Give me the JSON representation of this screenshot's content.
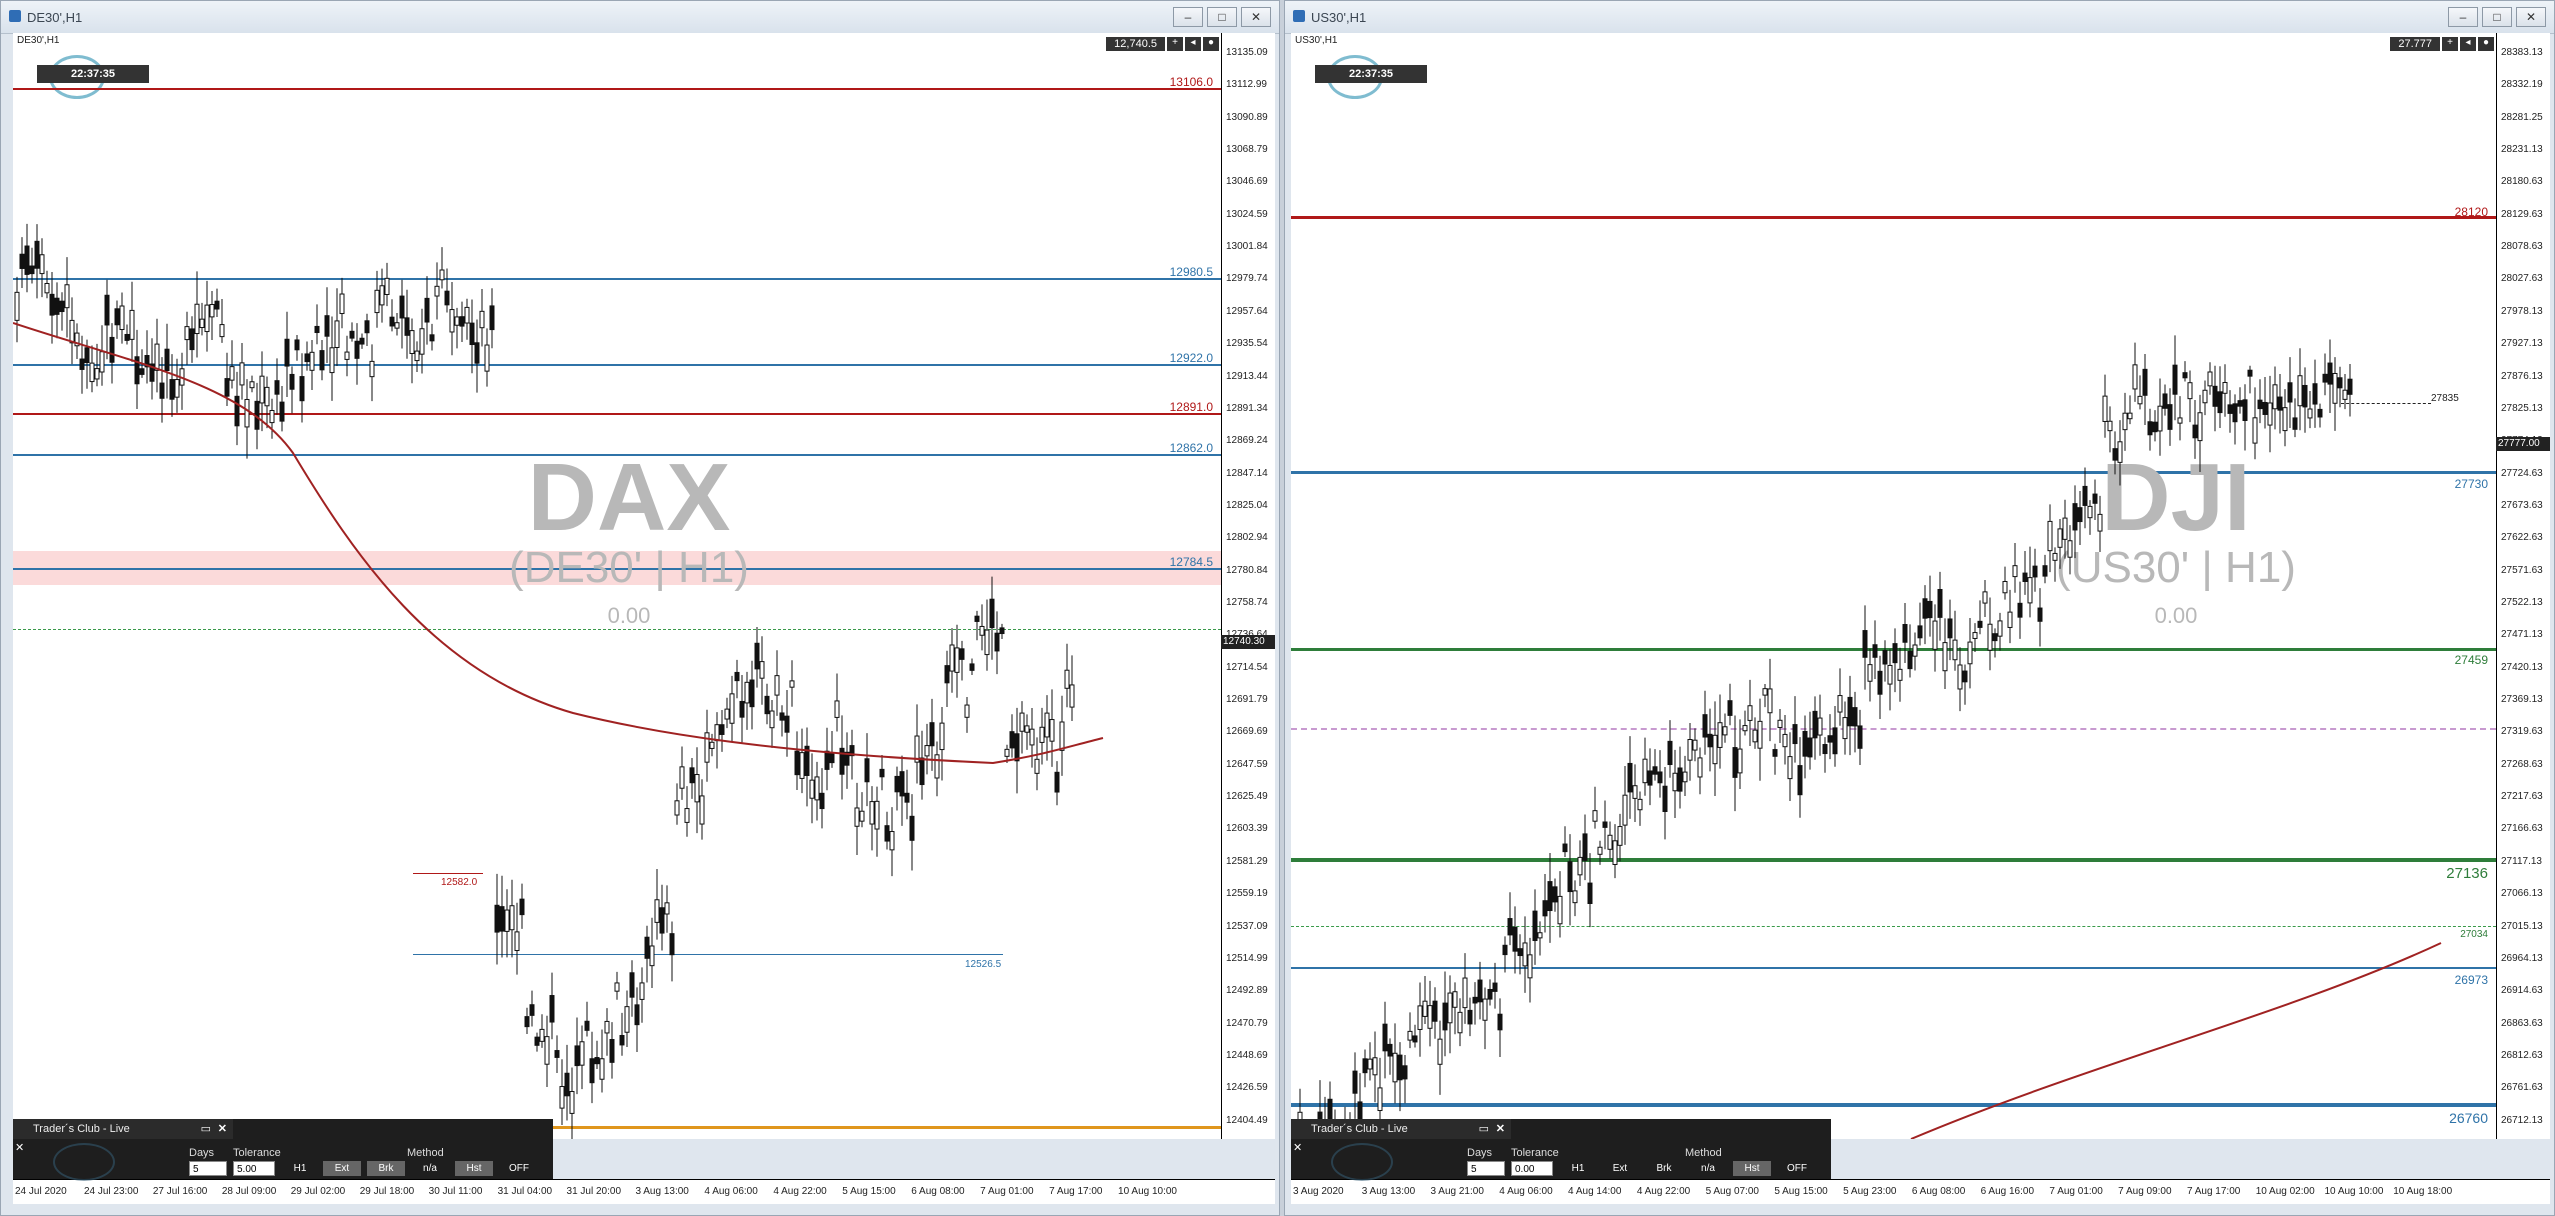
{
  "left": {
    "window_title": "DE30',H1",
    "symbol_label": "DE30',H1",
    "clock": "22:37:35",
    "price": "12,740.5",
    "watermark": {
      "big": "DAX",
      "mid": "(DE30' | H1)",
      "small": "0.00"
    },
    "y_ticks": [
      "13135.09",
      "13112.99",
      "13090.89",
      "13068.79",
      "13046.69",
      "13024.59",
      "13001.84",
      "12979.74",
      "12957.64",
      "12935.54",
      "12913.44",
      "12891.34",
      "12869.24",
      "12847.14",
      "12825.04",
      "12802.94",
      "12780.84",
      "12758.74",
      "12736.64",
      "12714.54",
      "12691.79",
      "12669.69",
      "12647.59",
      "12625.49",
      "12603.39",
      "12581.29",
      "12559.19",
      "12537.09",
      "12514.99",
      "12492.89",
      "12470.79",
      "12448.69",
      "12426.59",
      "12404.49"
    ],
    "x_ticks": [
      "24 Jul 2020",
      "24 Jul 23:00",
      "27 Jul 16:00",
      "28 Jul 09:00",
      "29 Jul 02:00",
      "29 Jul 18:00",
      "30 Jul 11:00",
      "31 Jul 04:00",
      "31 Jul 20:00",
      "3 Aug 13:00",
      "4 Aug 06:00",
      "4 Aug 22:00",
      "5 Aug 15:00",
      "6 Aug 08:00",
      "7 Aug 01:00",
      "7 Aug 17:00",
      "10 Aug 10:00"
    ],
    "levels": [
      {
        "label": "13106.0",
        "color": "#b01818"
      },
      {
        "label": "12980.5",
        "color": "#2f73a8"
      },
      {
        "label": "12922.0",
        "color": "#2f73a8"
      },
      {
        "label": "12891.0",
        "color": "#b01818"
      },
      {
        "label": "12862.0",
        "color": "#2f73a8"
      },
      {
        "label": "12784.5",
        "color": "#2f73a8"
      },
      {
        "label": "12582.0",
        "color": "#b01818"
      },
      {
        "label": "12526.5",
        "color": "#2f73a8"
      }
    ],
    "current_price_tag": "12740.30"
  },
  "right": {
    "window_title": "US30',H1",
    "symbol_label": "US30',H1",
    "clock": "22:37:35",
    "price": "27.777",
    "watermark": {
      "big": "DJI",
      "mid": "(US30' | H1)",
      "small": "0.00"
    },
    "y_ticks": [
      "28383.13",
      "28332.19",
      "28281.25",
      "28231.13",
      "28180.63",
      "28129.63",
      "28078.63",
      "28027.63",
      "27978.13",
      "27927.13",
      "27876.13",
      "27825.13",
      "27774.13",
      "27724.63",
      "27673.63",
      "27622.63",
      "27571.63",
      "27522.13",
      "27471.13",
      "27420.13",
      "27369.13",
      "27319.63",
      "27268.63",
      "27217.63",
      "27166.63",
      "27117.13",
      "27066.13",
      "27015.13",
      "26964.13",
      "26914.63",
      "26863.63",
      "26812.63",
      "26761.63",
      "26712.13"
    ],
    "x_ticks": [
      "3 Aug 2020",
      "3 Aug 13:00",
      "3 Aug 21:00",
      "4 Aug 06:00",
      "4 Aug 14:00",
      "4 Aug 22:00",
      "5 Aug 07:00",
      "5 Aug 15:00",
      "5 Aug 23:00",
      "6 Aug 08:00",
      "6 Aug 16:00",
      "7 Aug 01:00",
      "7 Aug 09:00",
      "7 Aug 17:00",
      "10 Aug 02:00",
      "10 Aug 10:00",
      "10 Aug 18:00"
    ],
    "levels": [
      {
        "label": "28120",
        "color": "#b01818"
      },
      {
        "label": "27835",
        "color": "#222222"
      },
      {
        "label": "27730",
        "color": "#2f73a8"
      },
      {
        "label": "27459",
        "color": "#2e7d3a"
      },
      {
        "label": "27136",
        "color": "#2e7d3a"
      },
      {
        "label": "27034",
        "color": "#2e7d3a"
      },
      {
        "label": "26973",
        "color": "#2f73a8"
      },
      {
        "label": "26760",
        "color": "#2f73a8"
      }
    ],
    "current_price_tag": "27777.00"
  },
  "panel": {
    "title": "Trader´s Club - Live",
    "days_label": "Days",
    "tolerance_label": "Tolerance",
    "method_label": "Method",
    "left": {
      "days": "5",
      "tolerance": "5.00"
    },
    "right": {
      "days": "5",
      "tolerance": "0.00"
    },
    "btn_h1": "H1",
    "btn_ext": "Ext",
    "btn_brk": "Brk",
    "btn_na": "n/a",
    "btn_hst": "Hst",
    "btn_off": "OFF"
  },
  "window_buttons": {
    "min": "–",
    "max": "□",
    "close": "✕"
  }
}
